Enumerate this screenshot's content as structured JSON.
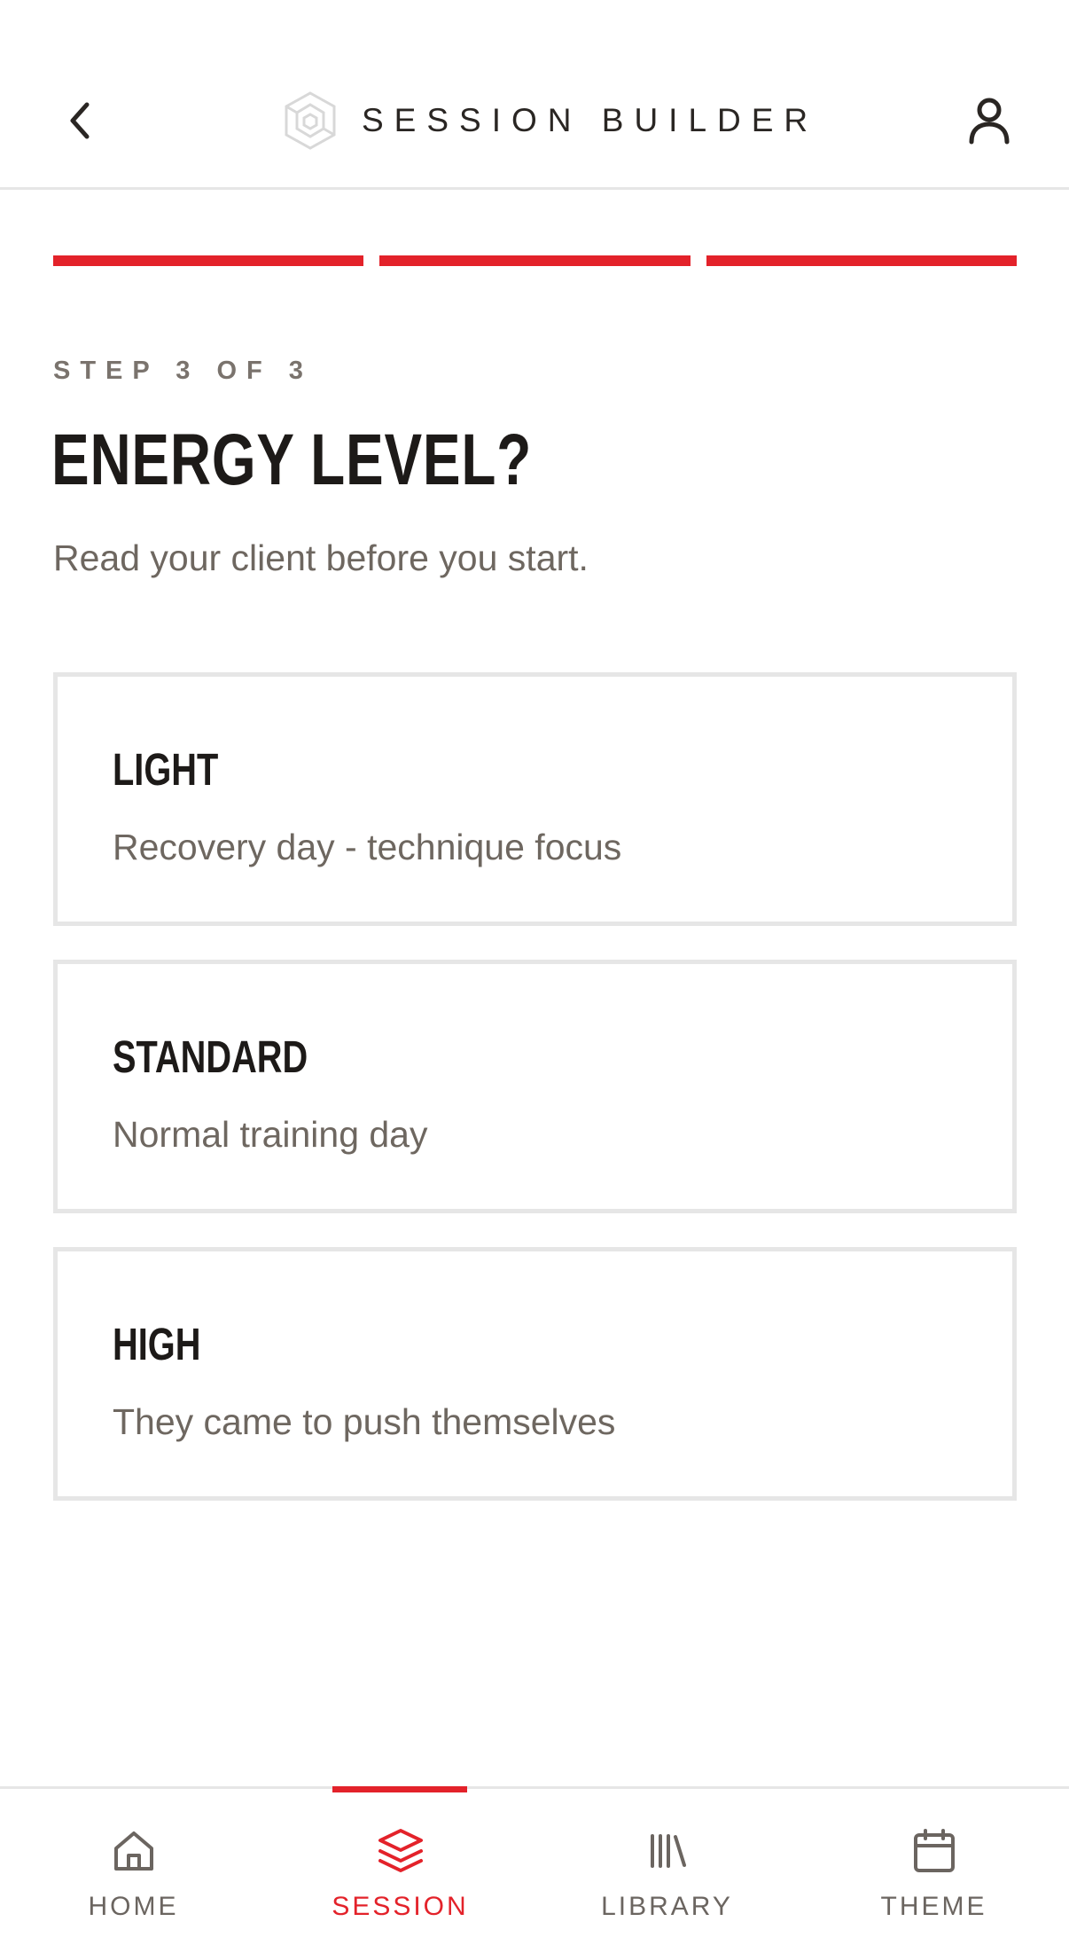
{
  "colors": {
    "accent": "#e3222a",
    "text_dark": "#1d1a18",
    "text_muted": "#6e6760",
    "border": "#e6e6e6",
    "nav_inactive": "#6b6560"
  },
  "header": {
    "title": "SESSION BUILDER",
    "back_icon": "chevron-left-icon",
    "logo_icon": "hexagon-logo-icon",
    "profile_icon": "user-icon"
  },
  "progress": {
    "total_steps": 3,
    "completed_steps": 3
  },
  "step": {
    "label": "STEP 3 OF 3",
    "title": "ENERGY LEVEL?",
    "subtitle": "Read your client before you start."
  },
  "options": [
    {
      "title": "LIGHT",
      "description": "Recovery day - technique focus"
    },
    {
      "title": "STANDARD",
      "description": "Normal training day"
    },
    {
      "title": "HIGH",
      "description": "They came to push themselves"
    }
  ],
  "nav": [
    {
      "label": "HOME",
      "icon": "home-icon",
      "active": false
    },
    {
      "label": "SESSION",
      "icon": "layers-icon",
      "active": true
    },
    {
      "label": "LIBRARY",
      "icon": "library-icon",
      "active": false
    },
    {
      "label": "THEME",
      "icon": "calendar-icon",
      "active": false
    }
  ]
}
